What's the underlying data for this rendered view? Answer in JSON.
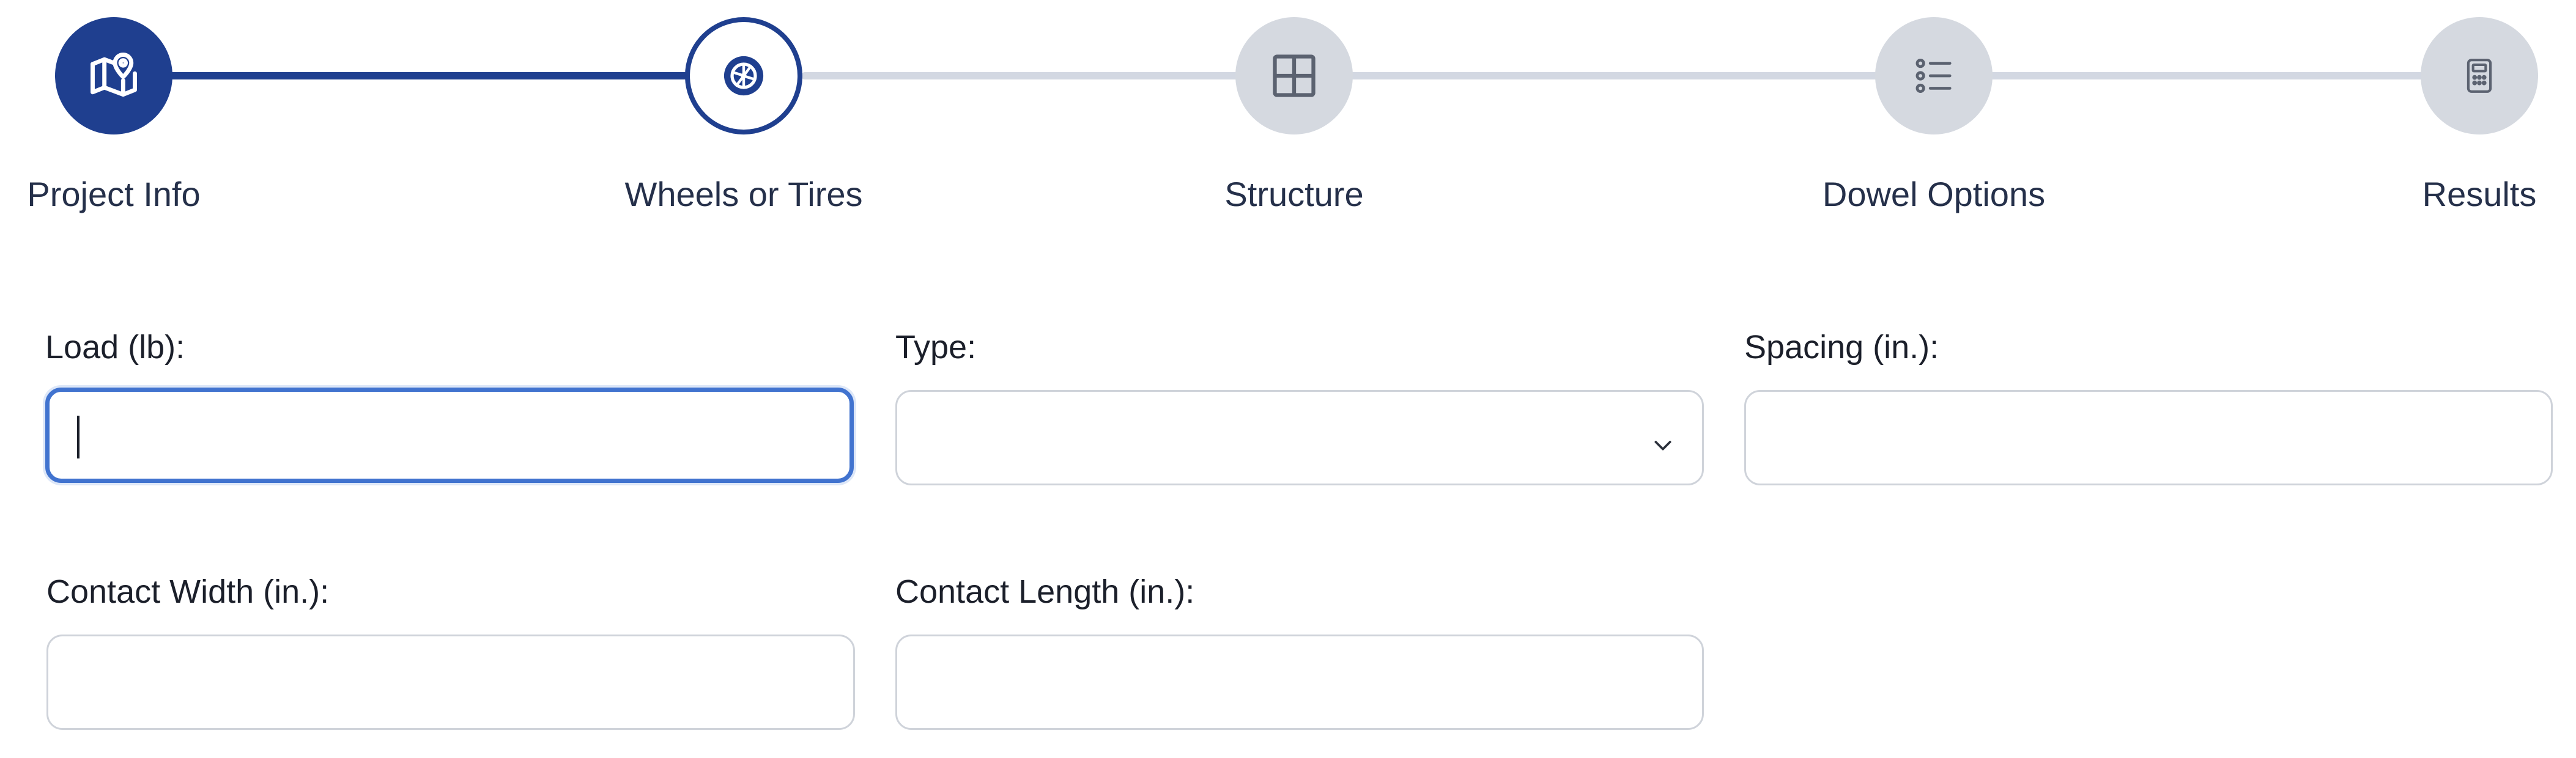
{
  "stepper": {
    "steps": [
      {
        "label": "Project Info",
        "state": "complete",
        "icon": "map-pin-icon"
      },
      {
        "label": "Wheels or Tires",
        "state": "active",
        "icon": "wheel-icon"
      },
      {
        "label": "Structure",
        "state": "pending",
        "icon": "grid-icon"
      },
      {
        "label": "Dowel Options",
        "state": "pending",
        "icon": "list-icon"
      },
      {
        "label": "Results",
        "state": "pending",
        "icon": "calculator-icon"
      }
    ]
  },
  "form": {
    "load": {
      "label": "Load (lb):",
      "value": ""
    },
    "type": {
      "label": "Type:",
      "value": ""
    },
    "spacing": {
      "label": "Spacing (in.):",
      "value": ""
    },
    "contact_width": {
      "label": "Contact Width (in.):",
      "value": ""
    },
    "contact_length": {
      "label": "Contact Length (in.):",
      "value": ""
    }
  },
  "colors": {
    "accent": "#1f3f8f",
    "focus": "#4173cf",
    "pending": "#d5d9e0",
    "track_todo": "#d3d8e2"
  }
}
